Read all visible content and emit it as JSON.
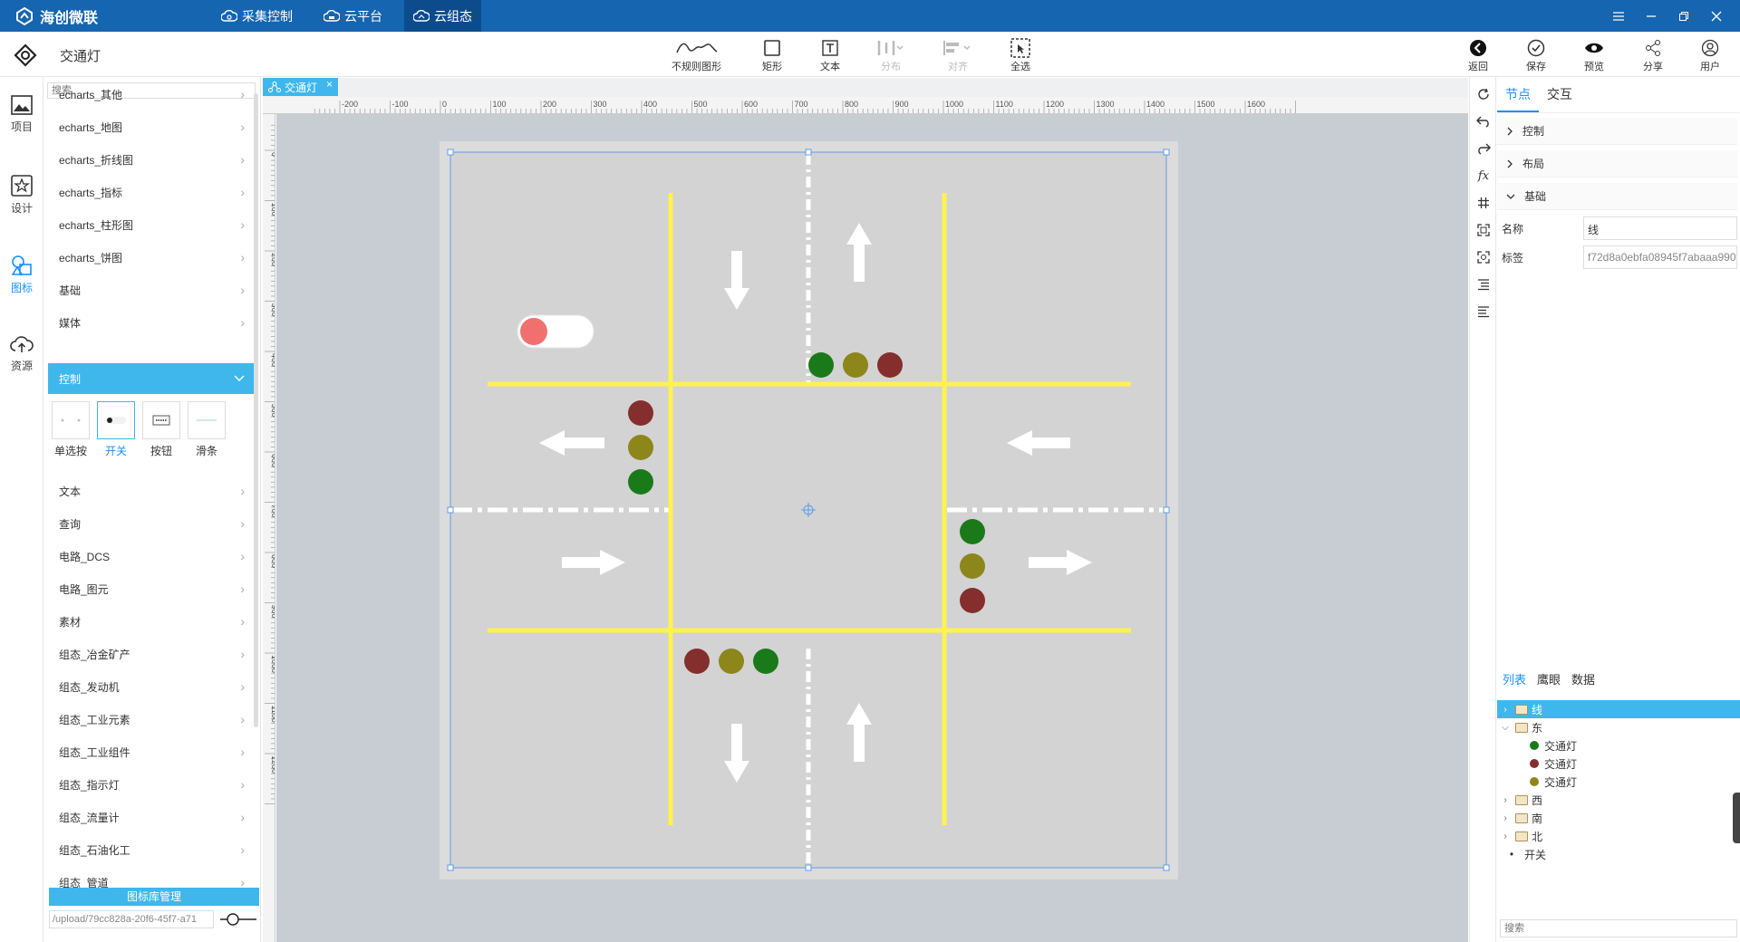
{
  "app": {
    "name": "海创微联",
    "doc_title": "交通灯"
  },
  "topnav": [
    {
      "label": "采集控制",
      "icon": "cloud-gear-icon",
      "active": false
    },
    {
      "label": "云平台",
      "icon": "cloud-platform-icon",
      "active": false
    },
    {
      "label": "云组态",
      "icon": "cloud-config-icon",
      "active": true
    }
  ],
  "toolbar": {
    "irregular": "不规则图形",
    "rect": "矩形",
    "text": "文本",
    "distribute": "分布",
    "align": "对齐",
    "select_all": "全选",
    "back": "返回",
    "save": "保存",
    "preview": "预览",
    "share": "分享",
    "user": "用户"
  },
  "rail": [
    {
      "label": "项目",
      "icon": "image-icon",
      "active": false
    },
    {
      "label": "设计",
      "icon": "star-frame-icon",
      "active": false
    },
    {
      "label": "图标",
      "icon": "shapes-icon",
      "active": true
    },
    {
      "label": "资源",
      "icon": "cloud-upload-icon",
      "active": false
    }
  ],
  "panel": {
    "search_placeholder": "搜索",
    "categories_top": [
      "echarts_其他",
      "echarts_地图",
      "echarts_折线图",
      "echarts_指标",
      "echarts_柱形图",
      "echarts_饼图",
      "基础",
      "媒体"
    ],
    "active_category": "控制",
    "components": [
      "单选按",
      "开关",
      "按钮",
      "滑条"
    ],
    "selected_component": "开关",
    "categories_bottom": [
      "文本",
      "查询",
      "电路_DCS",
      "电路_图元",
      "素材",
      "组态_冶金矿产",
      "组态_发动机",
      "组态_工业元素",
      "组态_工业组件",
      "组态_指示灯",
      "组态_流量计",
      "组态_石油化工",
      "组态_管道"
    ],
    "library_button": "图标库管理",
    "path_value": "/upload/79cc828a-20f6-45f7-a71"
  },
  "canvas": {
    "tab_label": "交通灯",
    "ruler_h": [
      "-200",
      "-100",
      "0",
      "100",
      "200",
      "300",
      "400",
      "500",
      "600",
      "700",
      "800",
      "900",
      "1000",
      "1100",
      "1200",
      "1300",
      "1400",
      "1500",
      "1600"
    ],
    "ruler_v": [
      "0",
      "100",
      "200",
      "300",
      "400",
      "500",
      "600",
      "700",
      "800",
      "900",
      "1000",
      "1100",
      "1200"
    ],
    "colors": {
      "road": "#d3d3d3",
      "lane": "#fff24d",
      "green": "#1a7a1a",
      "yellow": "#8d861a",
      "red": "#842e2e",
      "toggle_knob": "#f07070"
    }
  },
  "props": {
    "tabs": [
      "节点",
      "交互"
    ],
    "active_tab": "节点",
    "sections": [
      "控制",
      "布局",
      "基础"
    ],
    "name_label": "名称",
    "name_value": "线",
    "tag_label": "标签",
    "tag_value": "f72d8a0ebfa08945f7abaaa990",
    "list_tabs": [
      "列表",
      "鹰眼",
      "数据"
    ],
    "active_list_tab": "列表",
    "tree": [
      {
        "label": "线",
        "type": "folder",
        "expanded": false,
        "selected": true,
        "level": 0
      },
      {
        "label": "东",
        "type": "folder",
        "expanded": true,
        "selected": false,
        "level": 0
      },
      {
        "label": "交通灯",
        "type": "light",
        "color": "#1a7a1a",
        "level": 1
      },
      {
        "label": "交通灯",
        "type": "light",
        "color": "#842e2e",
        "level": 1
      },
      {
        "label": "交通灯",
        "type": "light",
        "color": "#8d861a",
        "level": 1
      },
      {
        "label": "西",
        "type": "folder",
        "expanded": false,
        "selected": false,
        "level": 0
      },
      {
        "label": "南",
        "type": "folder",
        "expanded": false,
        "selected": false,
        "level": 0
      },
      {
        "label": "北",
        "type": "folder",
        "expanded": false,
        "selected": false,
        "level": 0
      },
      {
        "label": "开关",
        "type": "item",
        "level": 0
      }
    ],
    "bottom_search_placeholder": "搜索"
  }
}
